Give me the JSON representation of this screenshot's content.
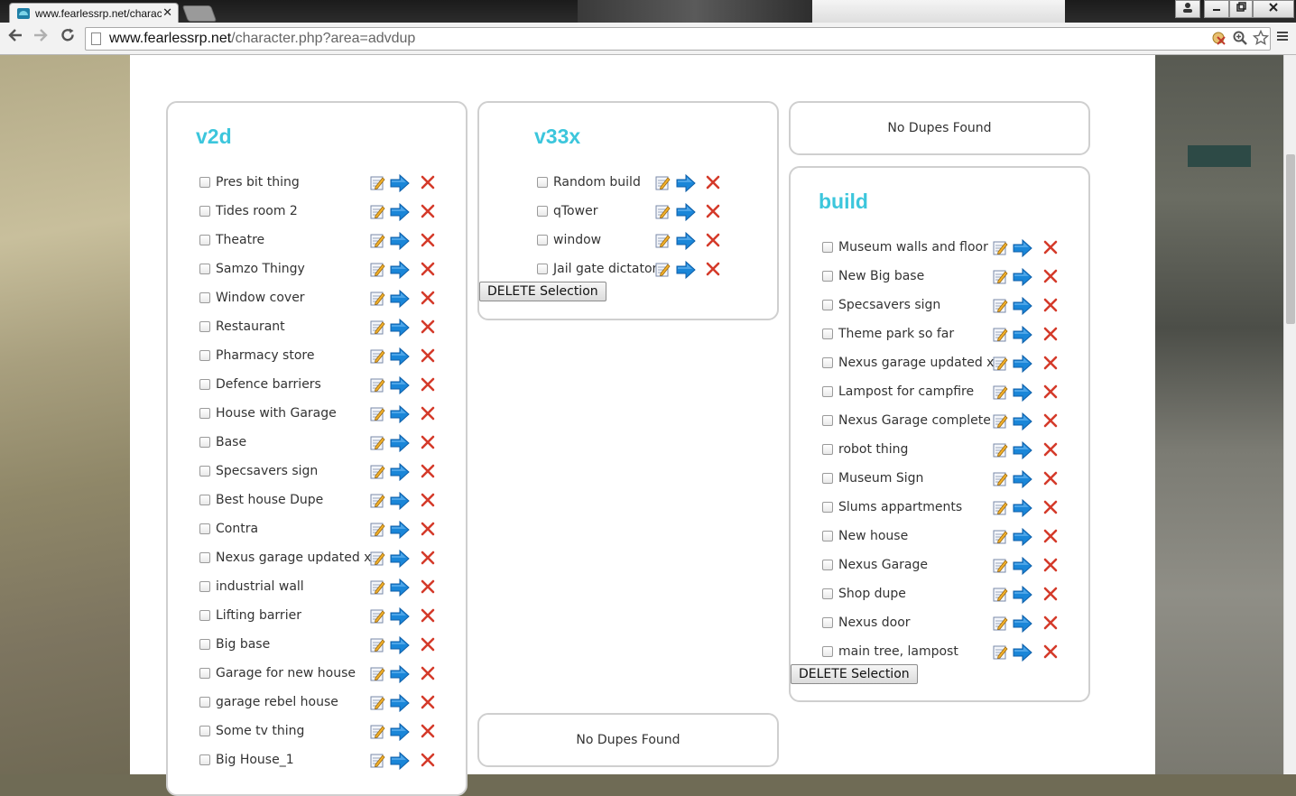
{
  "browser": {
    "tab_title": "www.fearlessrp.net/charac",
    "tab_close": "✕",
    "url_host": "www.fearlessrp.net",
    "url_path": "/character.php?area=advdup"
  },
  "columns": [
    {
      "title": "v2d",
      "items": [
        "Pres bit thing",
        "Tides room 2",
        "Theatre",
        "Samzo Thingy",
        "Window cover",
        "Restaurant",
        "Pharmacy store",
        "Defence barriers",
        "House with Garage",
        "Base",
        "Specsavers sign",
        "Best house Dupe",
        "Contra",
        "Nexus garage updated x1",
        "industrial wall",
        "Lifting barrier",
        "Big base",
        "Garage for new house",
        "garage rebel house",
        "Some tv thing",
        "Big House_1"
      ]
    },
    {
      "title": "v33x",
      "items": [
        "Random build",
        "qTower",
        "window",
        "Jail gate dictator"
      ],
      "delete_label": "DELETE Selection"
    },
    {
      "title": "build",
      "items": [
        "Museum walls and floor",
        "New Big base",
        "Specsavers sign",
        "Theme park so far",
        "Nexus garage updated x1",
        "Lampost for campfire",
        "Nexus Garage complete",
        "robot thing",
        "Museum Sign",
        "Slums appartments",
        "New house",
        "Nexus Garage",
        "Shop dupe",
        "Nexus door",
        "main tree, lampost"
      ],
      "delete_label": "DELETE Selection"
    }
  ],
  "notices": {
    "top_right": "No Dupes Found",
    "bottom_middle": "No Dupes Found"
  },
  "icons": {
    "edit": "edit-icon",
    "load": "load-arrow-icon",
    "delete": "delete-x-icon"
  },
  "colors": {
    "heading": "#3cc6dc",
    "arrow": "#1a86d8",
    "delete": "#d43a2a"
  }
}
